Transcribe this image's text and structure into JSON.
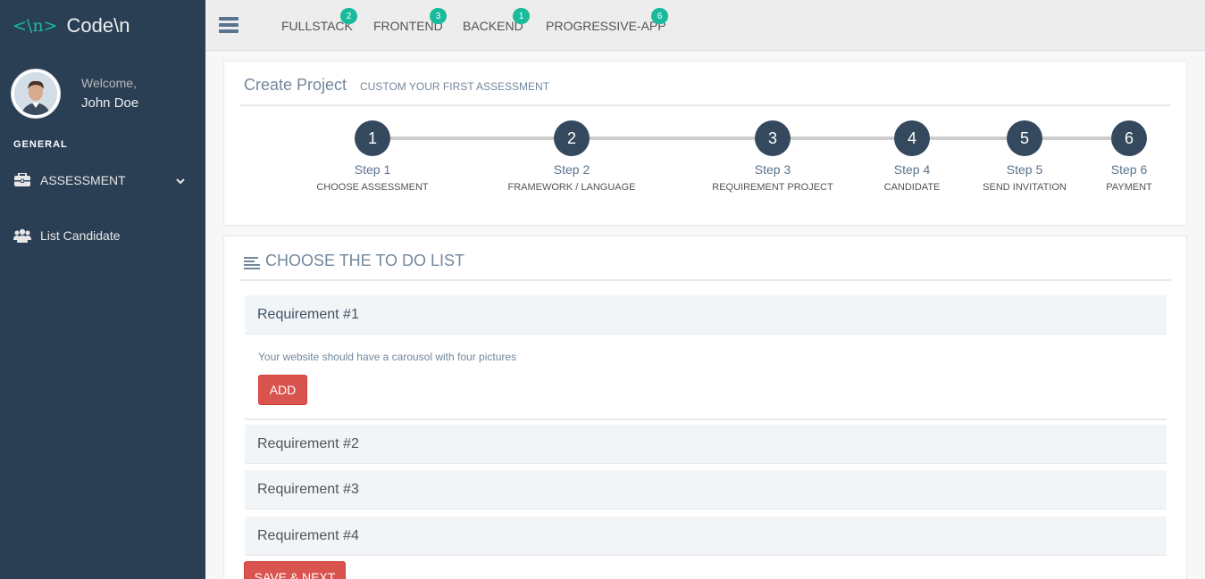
{
  "sidebar": {
    "logo_mark": "<\\n>",
    "logo_text": "Code\\n",
    "welcome": "Welcome,",
    "username": "John Doe",
    "section_title": "GENERAL",
    "items": [
      {
        "label": "ASSESSMENT",
        "icon": "briefcase-icon"
      },
      {
        "label": "List Candidate",
        "icon": "users-icon"
      }
    ]
  },
  "topnav": {
    "tabs": [
      {
        "label": "FULLSTACK",
        "badge": "2"
      },
      {
        "label": "FRONTEND",
        "badge": "3"
      },
      {
        "label": "BACKEND",
        "badge": "1"
      },
      {
        "label": "PROGRESSIVE-APP",
        "badge": "6"
      }
    ]
  },
  "create_project": {
    "title": "Create Project",
    "subtitle": "CUSTOM YOUR FIRST ASSESSMENT",
    "steps": [
      {
        "number": "1",
        "label": "Step 1",
        "desc": "CHOOSE ASSESSMENT"
      },
      {
        "number": "2",
        "label": "Step 2",
        "desc": "FRAMEWORK / LANGUAGE"
      },
      {
        "number": "3",
        "label": "Step 3",
        "desc": "REQUIREMENT PROJECT"
      },
      {
        "number": "4",
        "label": "Step 4",
        "desc": "CANDIDATE"
      },
      {
        "number": "5",
        "label": "Step 5",
        "desc": "SEND INVITATION"
      },
      {
        "number": "6",
        "label": "Step 6",
        "desc": "PAYMENT"
      }
    ]
  },
  "todo": {
    "title": "CHOOSE THE TO DO LIST",
    "requirements": [
      {
        "title": "Requirement #1",
        "desc": "Your website should have a carousol with four pictures",
        "add_label": "ADD"
      },
      {
        "title": "Requirement #2"
      },
      {
        "title": "Requirement #3"
      },
      {
        "title": "Requirement #4"
      }
    ],
    "save_label": "SAVE & NEXT"
  },
  "colors": {
    "sidebar_bg": "#2A3F54",
    "accent": "#1ABB9C",
    "step_circle": "#34495E",
    "danger": "#D9534F"
  }
}
